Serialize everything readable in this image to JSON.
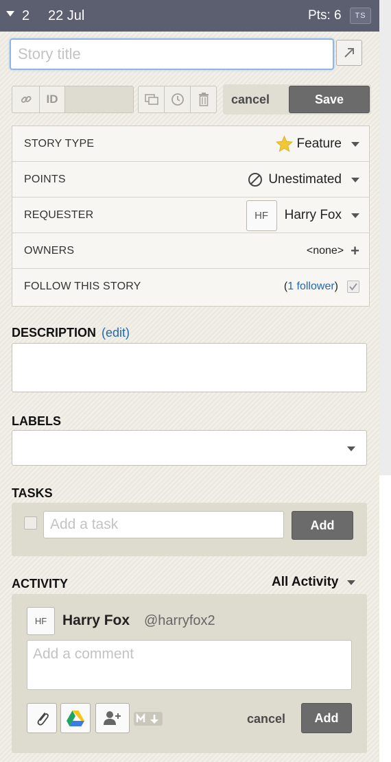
{
  "header": {
    "number": "2",
    "date": "22 Jul",
    "points": "Pts: 6",
    "badge": "TS"
  },
  "title": {
    "placeholder": "Story title",
    "value": ""
  },
  "toolbar": {
    "id_label": "ID",
    "cancel_label": "cancel",
    "save_label": "Save"
  },
  "info": {
    "story_type": {
      "label": "STORY TYPE",
      "value": "Feature",
      "icon": "star-icon",
      "icon_color": "#f2c736"
    },
    "points": {
      "label": "POINTS",
      "value": "Unestimated",
      "icon": "no-estimate-icon"
    },
    "requester": {
      "label": "REQUESTER",
      "initials": "HF",
      "value": "Harry Fox"
    },
    "owners": {
      "label": "OWNERS",
      "value": "<none>",
      "add": "+"
    },
    "follow": {
      "label": "FOLLOW THIS STORY",
      "paren_open": "(",
      "link": "1 follower",
      "paren_close": ")"
    }
  },
  "description": {
    "title": "DESCRIPTION",
    "edit_label": "(edit)"
  },
  "labels": {
    "title": "LABELS"
  },
  "tasks": {
    "title": "TASKS",
    "placeholder": "Add a task",
    "add_label": "Add"
  },
  "activity": {
    "title": "ACTIVITY",
    "filter": "All Activity",
    "user_initials": "HF",
    "user_name": "Harry Fox",
    "user_handle": "@harryfox2",
    "comment_placeholder": "Add a comment",
    "cancel_label": "cancel",
    "add_label": "Add"
  },
  "colors": {
    "header_bg": "#5b5f70",
    "link": "#2068b0",
    "button_dark": "#6b6b6b",
    "focus_border": "#8db6e6"
  }
}
